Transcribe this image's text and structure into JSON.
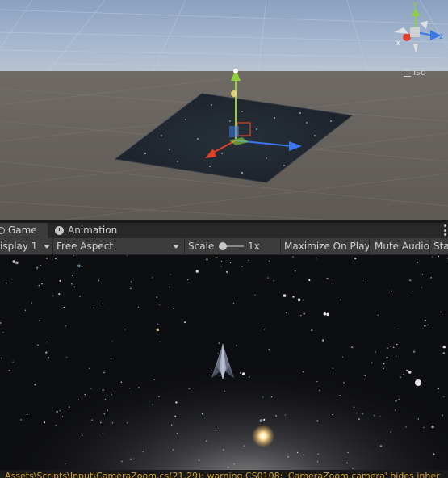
{
  "scene_view": {
    "projection_label": "Iso",
    "gizmo_axes": {
      "x": "x",
      "y": "y",
      "z": "z"
    }
  },
  "tabs": [
    {
      "label": "Game",
      "icon": "game-controller-icon",
      "active": true
    },
    {
      "label": "Animation",
      "icon": "clock-icon",
      "active": false
    }
  ],
  "game_toolbar": {
    "display": "isplay 1",
    "aspect": "Free Aspect",
    "scale_label": "Scale",
    "scale_value": "1x",
    "maximize": "Maximize On Play",
    "mute": "Mute Audio",
    "stats": "Sta"
  },
  "console_warning": "Assets\\Scripts\\Input\\CameraZoom.cs(21,29): warning CS0108: 'CameraZoom.camera' hides inher",
  "colors": {
    "x_axis": "#e0402a",
    "y_axis": "#8fd23c",
    "z_axis": "#3a78e8",
    "warning": "#d4a21a",
    "panel": "#3c3c3c"
  }
}
